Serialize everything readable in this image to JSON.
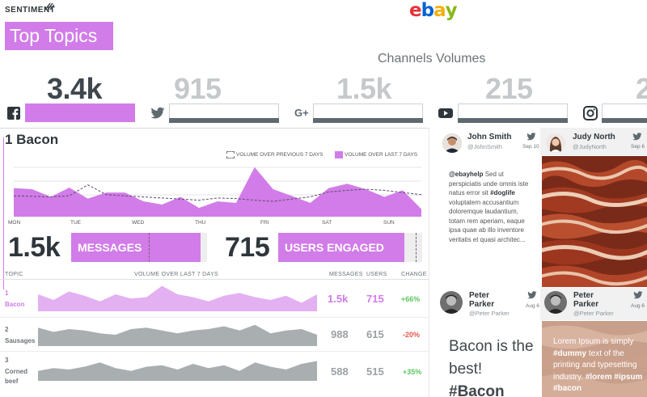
{
  "header": {
    "brand": "SENTIMENT",
    "ebay_letters": [
      "e",
      "b",
      "a",
      "y"
    ],
    "title": "Top Topics",
    "channels_title": "Channels Volumes"
  },
  "channels": [
    {
      "icon": "facebook-icon",
      "value": "3.4k",
      "highlight": true
    },
    {
      "icon": "twitter-icon",
      "value": "915",
      "highlight": false
    },
    {
      "icon": "google-plus-icon",
      "value": "1.5k",
      "highlight": false
    },
    {
      "icon": "youtube-icon",
      "value": "215",
      "highlight": false
    },
    {
      "icon": "instagram-icon",
      "value": "2",
      "highlight": false
    }
  ],
  "topic": {
    "title": "1 Bacon",
    "legend_prev": "VOLUME OVER PREVIOUS 7 DAYS",
    "legend_last": "VOLUME OVER LAST 7 DAYS",
    "days": [
      "MON",
      "TUE",
      "WED",
      "THU",
      "FRI",
      "SAT",
      "SUN"
    ],
    "messages_value": "1.5k",
    "messages_label": "MESSAGES",
    "users_value": "715",
    "users_label": "USERS ENGAGED"
  },
  "chart_data": {
    "type": "area",
    "x": [
      "MON",
      "TUE",
      "WED",
      "THU",
      "FRI",
      "SAT",
      "SUN"
    ],
    "series": [
      {
        "name": "VOLUME OVER LAST 7 DAYS",
        "values": [
          52,
          50,
          36,
          53,
          33,
          44,
          44,
          28,
          22,
          36,
          16,
          28,
          25,
          90,
          50,
          38,
          25,
          52,
          60,
          50,
          36,
          48,
          14
        ]
      },
      {
        "name": "VOLUME OVER PREVIOUS 7 DAYS",
        "values": [
          38,
          37,
          36,
          38,
          58,
          40,
          38,
          36,
          34,
          32,
          30,
          34,
          33,
          30,
          28,
          32,
          36,
          45,
          48,
          50,
          48,
          44,
          40
        ]
      }
    ],
    "ylim": [
      0,
      100
    ]
  },
  "table": {
    "headers": {
      "topic": "TOPIC",
      "volume": "VOLUME OVER LAST 7 DAYS",
      "messages": "MESSAGES",
      "users": "USERS",
      "change": "CHANGE"
    },
    "rows": [
      {
        "num": "1",
        "name": "Bacon",
        "messages": "1.5k",
        "users": "715",
        "change": "+66%",
        "dir": "up",
        "highlight": true,
        "spark": [
          60,
          40,
          70,
          55,
          35,
          60,
          45,
          50,
          90,
          60,
          50,
          35,
          55,
          65,
          50,
          40,
          55,
          30,
          60
        ]
      },
      {
        "num": "2",
        "name": "Sausages",
        "messages": "988",
        "users": "615",
        "change": "-20%",
        "dir": "down",
        "highlight": false,
        "spark": [
          65,
          50,
          60,
          55,
          45,
          40,
          60,
          65,
          55,
          45,
          55,
          60,
          70,
          55,
          75,
          45,
          55,
          60,
          40
        ]
      },
      {
        "num": "3",
        "name": "Corned beef",
        "messages": "588",
        "users": "515",
        "change": "+35%",
        "dir": "up",
        "highlight": false,
        "spark": [
          35,
          45,
          40,
          50,
          65,
          45,
          35,
          50,
          55,
          40,
          60,
          45,
          55,
          35,
          65,
          50,
          40,
          60,
          70
        ]
      }
    ]
  },
  "tweets": [
    {
      "name": "John Smith",
      "handle": "@JohnSmith",
      "date": "Sep 10",
      "body_pre": "@ebayhelp",
      "body_mid": " Sed ut perspiciatis unde omnis iste natus error sit ",
      "body_tag": "#doglife",
      "body_post": " voluptatem accusantium doloremque laudantium, totam rem aperiam, eaque ipsa quae ab illo inventore veritatis et quasi architec..."
    },
    {
      "name": "Judy North",
      "handle": "@JudyNorth",
      "date": "Sep 6"
    },
    {
      "name": "Peter Parker",
      "handle": "@Peter Parker",
      "date": "Aug 6",
      "quote_line1": "Bacon is the",
      "quote_line2": "best!",
      "quote_tag": "#Bacon"
    },
    {
      "name": "Peter Parker",
      "handle": "@Peter Parker",
      "date": "Aug 6",
      "overlay_pre": "Lorem Ipsum is simply ",
      "overlay_tag1": "#dummy",
      "overlay_mid": " text of the printing and typesetting industry. ",
      "overlay_tag2": "#lorem",
      "overlay_space": " ",
      "overlay_tag3": "#ipsum",
      "overlay_space2": " ",
      "overlay_tag4": "#bacon"
    }
  ],
  "colors": {
    "accent": "#d17ce8",
    "dark_bar": "#5e6a70",
    "gray_area": "#a9aeb1",
    "up": "#5cc760",
    "down": "#e8574a"
  }
}
